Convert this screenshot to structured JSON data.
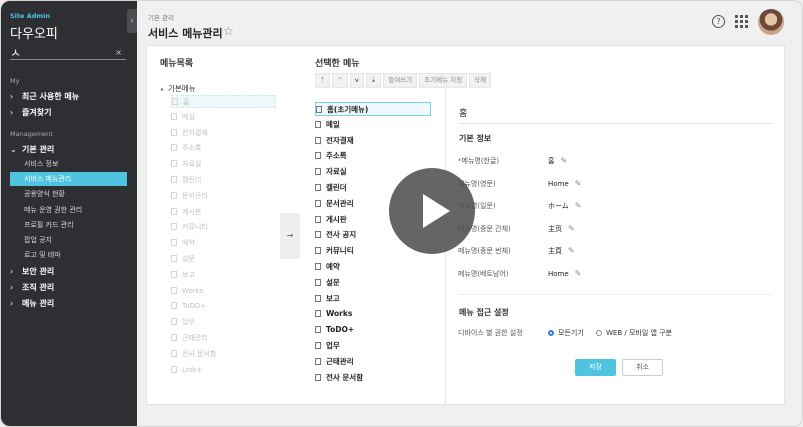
{
  "sidebar": {
    "site_label": "Site Admin",
    "company": "다우오피",
    "search_value": "ㅅ",
    "clear_icon": "×",
    "collapse_icon": "‹",
    "section_my": "My",
    "recent_menu": "최근 사용한 메뉴",
    "favorites": "즐겨찾기",
    "section_management": "Management",
    "basic_mgmt": "기본 관리",
    "sub_items": [
      "서비스 정보",
      "서비스 메뉴관리",
      "공용양식 현황",
      "메뉴 운영 권한 관리",
      "프로필 카드 관리",
      "팝업 공지",
      "로고 및 테마"
    ],
    "active_sub_index": 1,
    "security_mgmt": "보안 관리",
    "org_mgmt": "조직 관리",
    "menu_mgmt": "메뉴 관리"
  },
  "header": {
    "breadcrumb": "기본 관리",
    "title": "서비스 메뉴관리",
    "star_icon": "☆",
    "help_icon": "?"
  },
  "menu_list": {
    "title": "메뉴목록",
    "root": "기본메뉴",
    "items": [
      "홈",
      "메일",
      "전자결재",
      "주소록",
      "자료실",
      "캘린더",
      "문서관리",
      "게시판",
      "커뮤니티",
      "예약",
      "설문",
      "보고",
      "Works",
      "ToDO+",
      "업무",
      "근태관리",
      "전사 문서함",
      "Link+"
    ]
  },
  "move_button": "→",
  "selected_menu": {
    "title": "선택한 메뉴",
    "toolbar": [
      "⇡",
      "^",
      "v",
      "⇣",
      "들여쓰기",
      "초기메뉴 지정",
      "삭제"
    ],
    "items": [
      "홈(초기메뉴)",
      "메일",
      "전자결재",
      "주소록",
      "자료실",
      "캘린더",
      "문서관리",
      "게시판",
      "전사 공지",
      "커뮤니티",
      "예약",
      "설문",
      "보고",
      "Works",
      "ToDO+",
      "업무",
      "근태관리",
      "전사 문서함"
    ]
  },
  "detail": {
    "title": "홈",
    "basic_info": "기본 정보",
    "fields": [
      {
        "label": "메뉴명(한글)",
        "value": "홈",
        "required": true
      },
      {
        "label": "메뉴명(영문)",
        "value": "Home",
        "required": false
      },
      {
        "label": "메뉴명(일문)",
        "value": "ホーム",
        "required": false
      },
      {
        "label": "메뉴명(중문 간체)",
        "value": "主页",
        "required": false
      },
      {
        "label": "메뉴명(중문 번체)",
        "value": "主頁",
        "required": false
      },
      {
        "label": "메뉴명(베트남어)",
        "value": "Home",
        "required": false
      }
    ],
    "access_title": "메뉴 접근 설정",
    "device_label": "디바이스 별 권한 설정",
    "radio_all": "모든기기",
    "radio_split": "WEB / 모바일 앱 구분",
    "save": "저장",
    "cancel": "취소"
  },
  "colors": {
    "accent": "#4fc3e0",
    "sidebar_bg": "#2d2f33"
  }
}
